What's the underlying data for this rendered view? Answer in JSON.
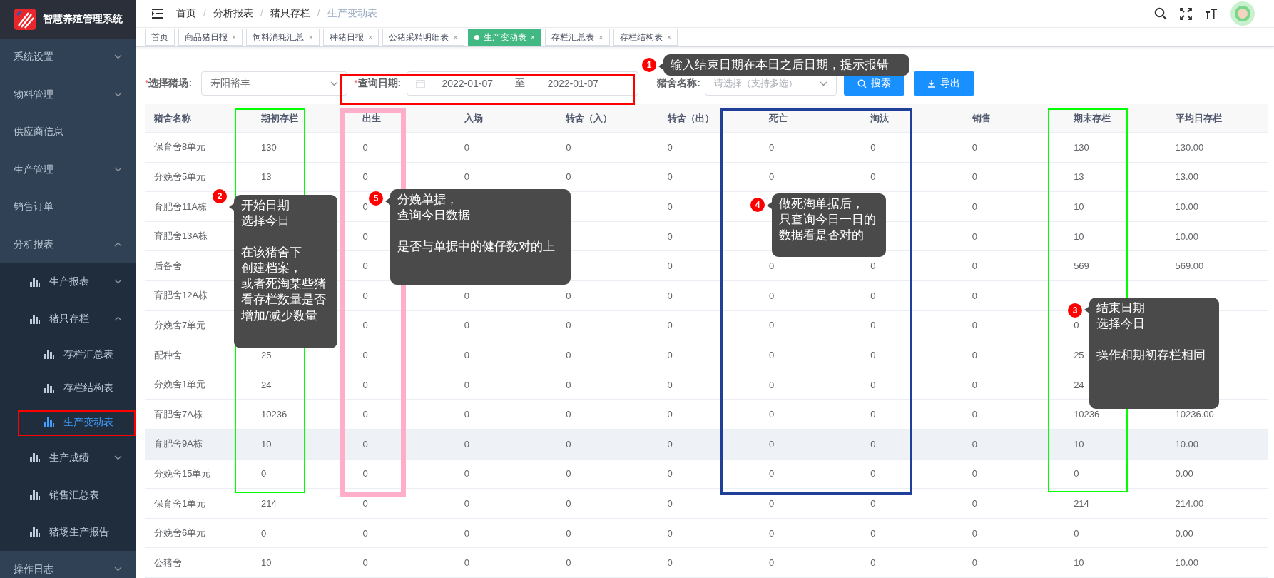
{
  "app": {
    "title": "智慧养殖管理系统"
  },
  "sidebar": {
    "items": [
      {
        "label": "系统设置",
        "kind": "submenu",
        "expanded": false
      },
      {
        "label": "物料管理",
        "kind": "submenu",
        "expanded": false
      },
      {
        "label": "供应商信息",
        "kind": "item",
        "selected": false
      },
      {
        "label": "生产管理",
        "kind": "submenu",
        "expanded": false
      },
      {
        "label": "销售订单",
        "kind": "item",
        "selected": false
      },
      {
        "label": "分析报表",
        "kind": "submenu",
        "expanded": true,
        "children": [
          {
            "label": "生产报表",
            "kind": "submenu",
            "expanded": false
          },
          {
            "label": "猪只存栏",
            "kind": "submenu",
            "expanded": true,
            "children": [
              {
                "label": "存栏汇总表",
                "kind": "item",
                "selected": false
              },
              {
                "label": "存栏结构表",
                "kind": "item",
                "selected": false
              },
              {
                "label": "生产变动表",
                "kind": "item",
                "selected": true
              }
            ]
          },
          {
            "label": "生产成绩",
            "kind": "submenu",
            "expanded": false
          },
          {
            "label": "销售汇总表",
            "kind": "item",
            "selected": false
          },
          {
            "label": "猪场生产报告",
            "kind": "item",
            "selected": false
          }
        ]
      },
      {
        "label": "操作日志",
        "kind": "submenu",
        "expanded": false
      }
    ]
  },
  "breadcrumb": [
    "首页",
    "分析报表",
    "猪只存栏",
    "生产变动表"
  ],
  "breadcrumb_separator": "/",
  "tabs": [
    {
      "label": "首页",
      "selected": false
    },
    {
      "label": "商品猪日报",
      "close": "×",
      "selected": false
    },
    {
      "label": "饲料消耗汇总",
      "close": "×",
      "selected": false
    },
    {
      "label": "种猪日报",
      "close": "×",
      "selected": false
    },
    {
      "label": "公猪采精明细表",
      "close": "×",
      "selected": false
    },
    {
      "label": "生产变动表",
      "close": "×",
      "selected": true
    },
    {
      "label": "存栏汇总表",
      "close": "×",
      "selected": false
    },
    {
      "label": "存栏结构表",
      "close": "×",
      "selected": false
    }
  ],
  "filters": {
    "farm": {
      "required_mark": "*",
      "label": "选择猪场:",
      "value": "寿阳裕丰"
    },
    "date": {
      "required_mark": "*",
      "label": "查询日期:",
      "start": "2022-01-07",
      "separator": "至",
      "end": "2022-01-07"
    },
    "house": {
      "label": "猪舍名称:",
      "placeholder": "请选择（支持多选）"
    },
    "buttons": [
      {
        "label": "搜索"
      },
      {
        "label": "导出"
      }
    ]
  },
  "table": {
    "columns": [
      "猪舍名称",
      "期初存栏",
      "出生",
      "入场",
      "转舍（入）",
      "转舍（出）",
      "死亡",
      "淘汰",
      "销售",
      "期末存栏",
      "平均日存栏"
    ],
    "rows": [
      {
        "hovered": false,
        "cells": [
          "保育舍8单元",
          "130",
          "0",
          "0",
          "0",
          "0",
          "0",
          "0",
          "0",
          "130",
          "130.00"
        ]
      },
      {
        "hovered": false,
        "cells": [
          "分娩舍5单元",
          "13",
          "0",
          "0",
          "0",
          "0",
          "0",
          "0",
          "0",
          "13",
          "13.00"
        ]
      },
      {
        "hovered": false,
        "cells": [
          "育肥舍11A栋",
          null,
          "0",
          null,
          null,
          "0",
          null,
          null,
          "0",
          "10",
          "10.00"
        ]
      },
      {
        "hovered": false,
        "cells": [
          "育肥舍13A栋",
          null,
          "0",
          null,
          null,
          "0",
          null,
          null,
          "0",
          "10",
          "10.00"
        ]
      },
      {
        "hovered": false,
        "cells": [
          "后备舍",
          null,
          "0",
          null,
          null,
          "0",
          "0",
          "0",
          "0",
          "569",
          "569.00"
        ]
      },
      {
        "hovered": false,
        "cells": [
          "育肥舍12A栋",
          null,
          "0",
          "0",
          "0",
          "0",
          "0",
          "0",
          "0",
          null,
          null
        ]
      },
      {
        "hovered": false,
        "cells": [
          "分娩舍7单元",
          null,
          "0",
          "0",
          "0",
          "0",
          "0",
          "0",
          "0",
          "0",
          null
        ]
      },
      {
        "hovered": false,
        "cells": [
          "配种舍",
          "25",
          "0",
          "0",
          "0",
          "0",
          "0",
          "0",
          "0",
          "25",
          null
        ]
      },
      {
        "hovered": false,
        "cells": [
          "分娩舍1单元",
          "24",
          "0",
          "0",
          "0",
          "0",
          "0",
          "0",
          "0",
          "24",
          null
        ]
      },
      {
        "hovered": false,
        "cells": [
          "育肥舍7A栋",
          "10236",
          "0",
          "0",
          "0",
          "0",
          "0",
          "0",
          "0",
          "10236",
          "10236.00"
        ]
      },
      {
        "hovered": true,
        "cells": [
          "育肥舍9A栋",
          "10",
          "0",
          "0",
          "0",
          "0",
          "0",
          "0",
          "0",
          "10",
          "10.00"
        ]
      },
      {
        "hovered": false,
        "cells": [
          "分娩舍15单元",
          "0",
          "0",
          "0",
          "0",
          "0",
          "0",
          "0",
          "0",
          "0",
          "0.00"
        ]
      },
      {
        "hovered": false,
        "cells": [
          "保育舍1单元",
          "214",
          "0",
          "0",
          "0",
          "0",
          "0",
          "0",
          "0",
          "214",
          "214.00"
        ]
      },
      {
        "hovered": false,
        "cells": [
          "分娩舍6单元",
          "0",
          "0",
          "0",
          "0",
          "0",
          "0",
          "0",
          "0",
          "0",
          "0.00"
        ]
      },
      {
        "hovered": false,
        "cells": [
          "公猪舍",
          "10",
          "0",
          "0",
          "0",
          "0",
          "0",
          "0",
          "0",
          "10",
          "10.00"
        ]
      }
    ]
  },
  "highlight_frames": [
    {
      "color": "#ff0000"
    },
    {
      "color": "#ff0000"
    },
    {
      "color": "#00ff00"
    },
    {
      "color": "#ffaec9"
    },
    {
      "color": "#1f3f99"
    },
    {
      "color": "#00ff00"
    }
  ],
  "callouts": [
    {
      "number": "1",
      "paragraphs": [
        [
          "输入结束日期在本日之后日期，提示报错"
        ]
      ]
    },
    {
      "number": "2",
      "paragraphs": [
        [
          "开始日期",
          "选择今日"
        ],
        [
          "在该猪舍下",
          "创建档案，",
          "或者死淘某些猪",
          "看存栏数量是否",
          "增加/减少数量"
        ]
      ]
    },
    {
      "number": "5",
      "paragraphs": [
        [
          "分娩单据，",
          "查询今日数据"
        ],
        [
          "是否与单据中的健仔数对的上"
        ]
      ]
    },
    {
      "number": "4",
      "paragraphs": [
        [
          "做死淘单据后，",
          "只查询今日一日的",
          "数据看是否对的"
        ]
      ]
    },
    {
      "number": "3",
      "paragraphs": [
        [
          "结束日期",
          "选择今日"
        ],
        [
          "操作和期初存栏相同"
        ]
      ]
    }
  ]
}
